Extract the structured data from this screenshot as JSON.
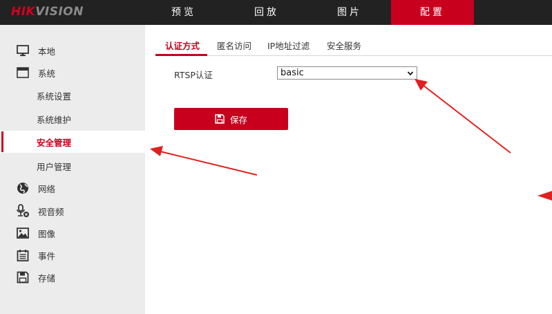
{
  "brand": {
    "logo_red": "HIK",
    "logo_gray": "VISION"
  },
  "colors": {
    "accent": "#c8001e",
    "topbar": "#222222",
    "sidebar": "#ececec",
    "annotation": "#e02020"
  },
  "nav": {
    "items": [
      {
        "label": "预览"
      },
      {
        "label": "回放"
      },
      {
        "label": "图片"
      },
      {
        "label": "配置",
        "active": true
      }
    ]
  },
  "sidebar": {
    "items": [
      {
        "label": "本地",
        "icon": "monitor-icon"
      },
      {
        "label": "系统",
        "icon": "window-icon"
      },
      {
        "label": "系统设置",
        "sub": true
      },
      {
        "label": "系统维护",
        "sub": true
      },
      {
        "label": "安全管理",
        "sub": true,
        "active": true
      },
      {
        "label": "用户管理",
        "sub": true
      },
      {
        "label": "网络",
        "icon": "globe-icon"
      },
      {
        "label": "视音频",
        "icon": "microphone-icon"
      },
      {
        "label": "图像",
        "icon": "image-icon"
      },
      {
        "label": "事件",
        "icon": "calendar-icon"
      },
      {
        "label": "存储",
        "icon": "floppy-disk-icon"
      }
    ]
  },
  "tabs": [
    {
      "label": "认证方式",
      "active": true
    },
    {
      "label": "匿名访问"
    },
    {
      "label": "IP地址过滤"
    },
    {
      "label": "安全服务"
    }
  ],
  "form": {
    "rtsp_label": "RTSP认证",
    "rtsp_value": "basic",
    "save_label": "保存"
  }
}
